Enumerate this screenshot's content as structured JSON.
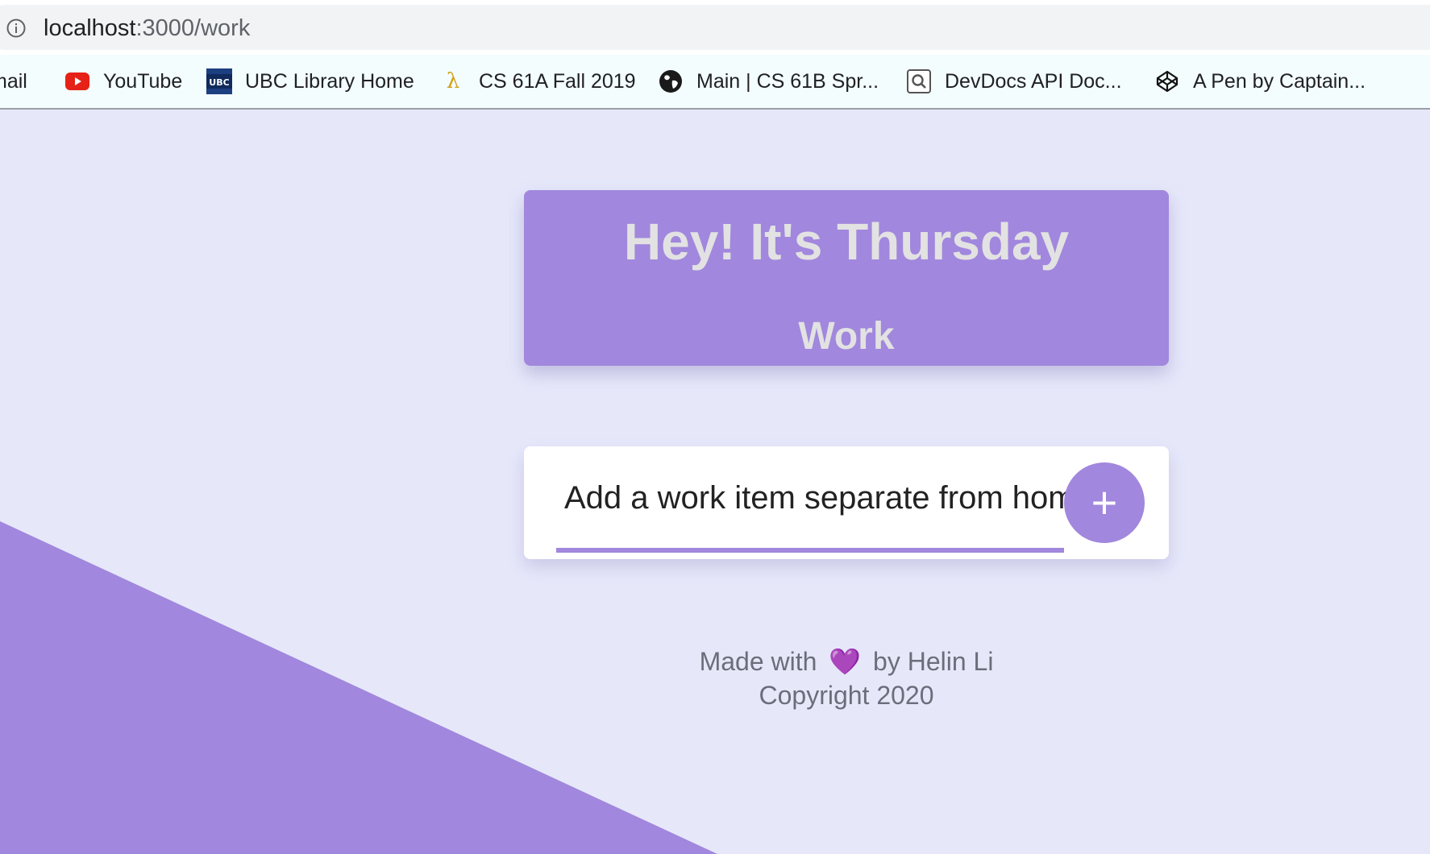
{
  "browser": {
    "url_host": "localhost",
    "url_rest": ":3000/work",
    "bookmarks": [
      {
        "label": "mail",
        "icon": "gmail-icon"
      },
      {
        "label": "YouTube",
        "icon": "youtube-icon"
      },
      {
        "label": "UBC Library Home",
        "icon": "ubc-icon"
      },
      {
        "label": "CS 61A Fall 2019",
        "icon": "lambda-icon"
      },
      {
        "label": "Main | CS 61B Spr...",
        "icon": "globe-icon"
      },
      {
        "label": "DevDocs API Doc...",
        "icon": "devdocs-icon"
      },
      {
        "label": "A Pen by Captain...",
        "icon": "codepen-icon"
      }
    ]
  },
  "heading": {
    "title": "Hey! It's Thursday",
    "list_name": "Work"
  },
  "new_item": {
    "value": "Add a work item separate from home",
    "button_label": "+"
  },
  "footer": {
    "made_with": "Made with",
    "heart": "💜",
    "by": "by Helin Li",
    "copyright": "Copyright 2020"
  },
  "colors": {
    "accent": "#a187dd",
    "background": "#e6e8fa",
    "heading_text": "#e2e2e2",
    "footer_text": "#6b6e7a"
  }
}
